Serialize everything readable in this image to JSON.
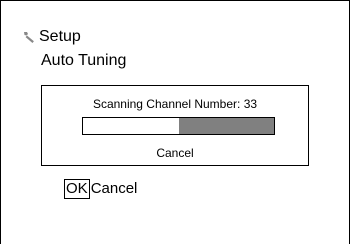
{
  "header": {
    "title": "Setup",
    "icon": "wrench-icon",
    "subtitle": "Auto Tuning"
  },
  "scan_dialog": {
    "status_text": "Scanning Channel Number: 33",
    "progress_unfilled_fraction": 0.5,
    "progress_fill_color": "#808080",
    "cancel_label": "Cancel"
  },
  "footer": {
    "ok_label": "OK",
    "cancel_label": "Cancel"
  }
}
